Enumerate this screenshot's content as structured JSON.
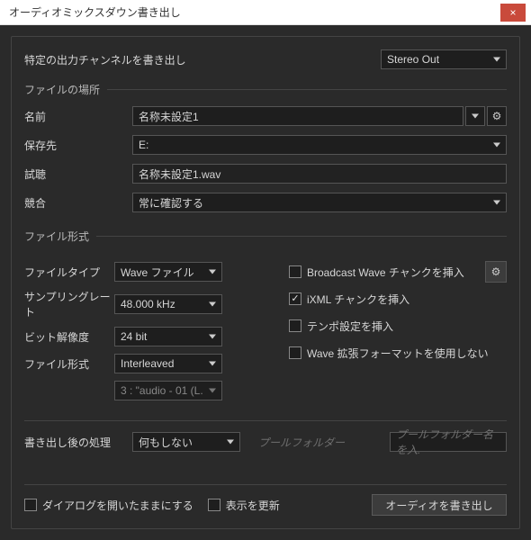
{
  "window": {
    "title": "オーディオミックスダウン書き出し",
    "close": "×"
  },
  "channel": {
    "label": "特定の出力チャンネルを書き出し",
    "value": "Stereo Out"
  },
  "file_location": {
    "legend": "ファイルの場所",
    "name_label": "名前",
    "name_value": "名称未設定1",
    "save_to_label": "保存先",
    "save_to_value": "E:",
    "preview_label": "試聴",
    "preview_value": "名称未設定1.wav",
    "conflict_label": "競合",
    "conflict_value": "常に確認する"
  },
  "file_format": {
    "legend": "ファイル形式",
    "file_type_label": "ファイルタイプ",
    "file_type_value": "Wave ファイル",
    "sample_rate_label": "サンプリングレート",
    "sample_rate_value": "48.000 kHz",
    "bit_depth_label": "ビット解像度",
    "bit_depth_value": "24 bit",
    "format_label": "ファイル形式",
    "format_value": "Interleaved",
    "sub_value": "3 : \"audio - 01 (L.",
    "options": {
      "broadcast_wave": "Broadcast Wave チャンクを挿入",
      "ixml": "iXML チャンクを挿入",
      "tempo": "テンポ設定を挿入",
      "wave_ext": "Wave 拡張フォーマットを使用しない"
    },
    "checked": {
      "ixml": true
    }
  },
  "post": {
    "label": "書き出し後の処理",
    "value": "何もしない",
    "pool_folder_label": "プールフォルダー",
    "pool_folder_ph": "プールフォルダー名を入."
  },
  "bottom": {
    "keep_open": "ダイアログを開いたままにする",
    "refresh": "表示を更新",
    "export_button": "オーディオを書き出し"
  }
}
